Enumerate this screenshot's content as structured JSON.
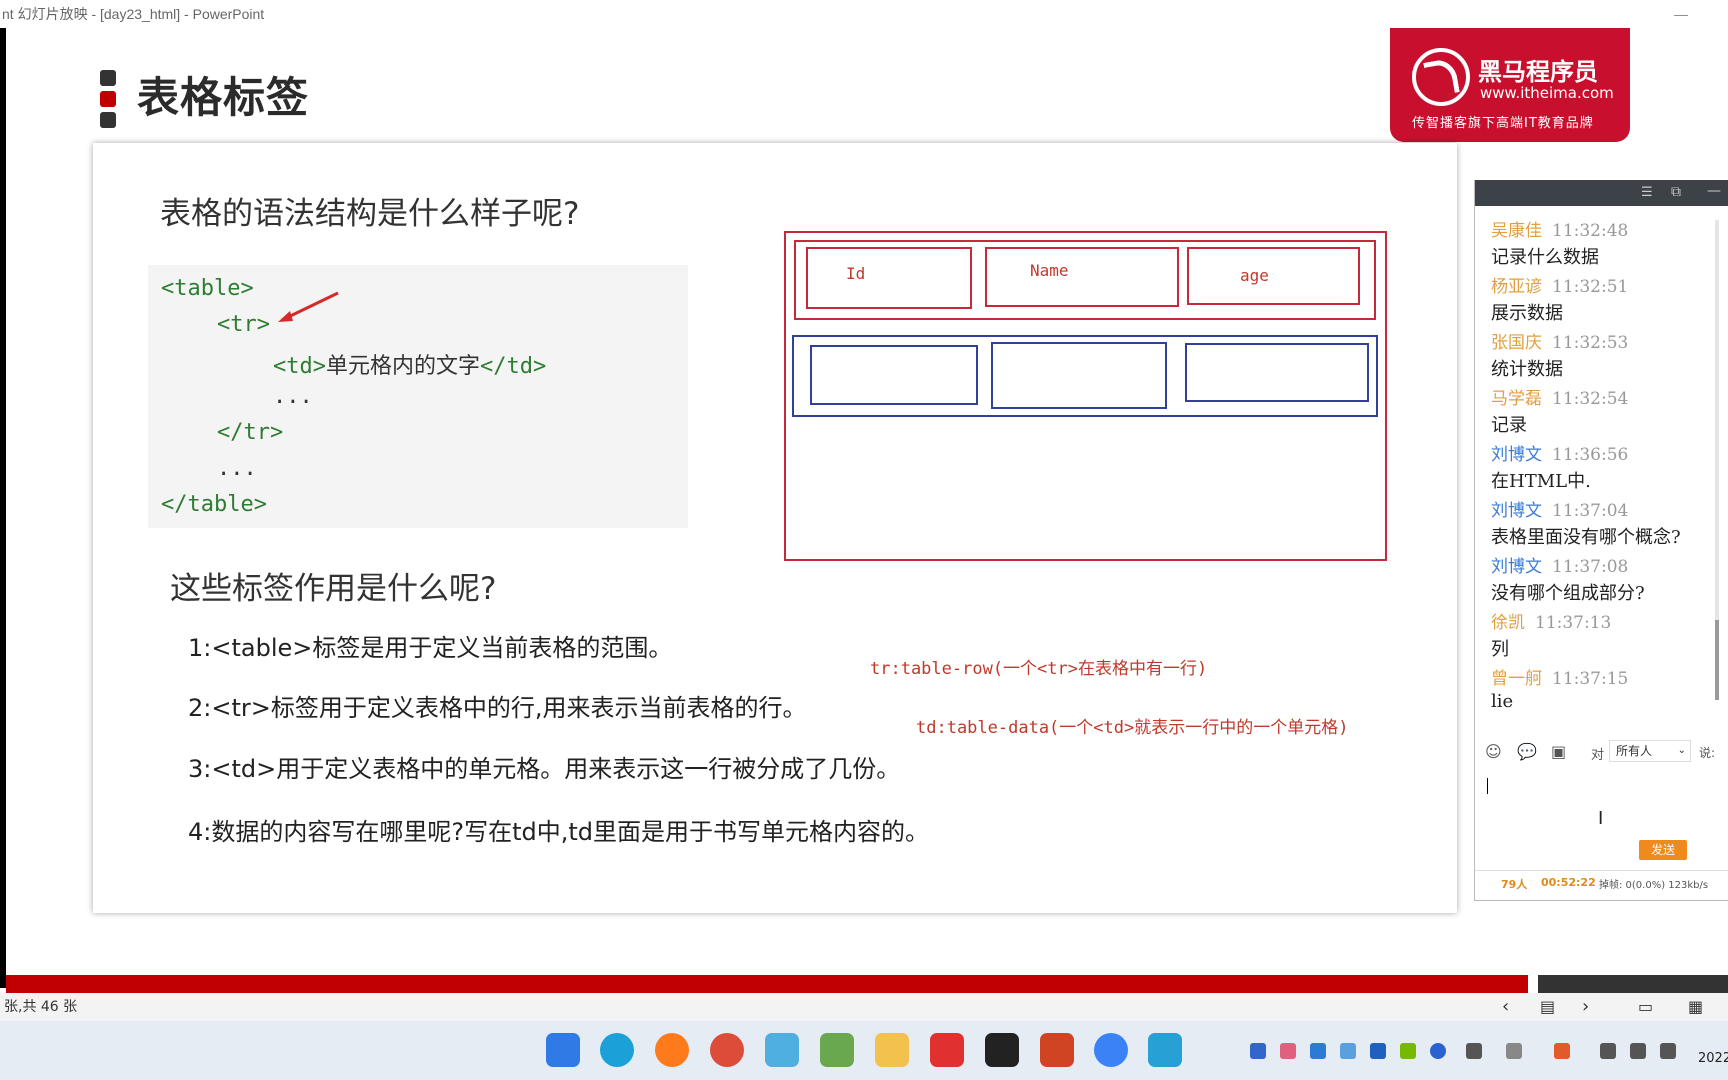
{
  "window": {
    "title": "nt 幻灯片放映 - [day23_html] - PowerPoint",
    "minimize": "—"
  },
  "slide": {
    "heading": "表格标签",
    "logo": {
      "name": "黑马程序员",
      "url": "www.itheima.com",
      "slogan": "传智播客旗下高端IT教育品牌"
    },
    "question1": "表格的语法结构是什么样子呢?",
    "code": {
      "l1": "<table>",
      "l2": "<tr>",
      "l3a": "<td>",
      "l3b": "单元格内的文字",
      "l3c": "</td>",
      "l4": "...",
      "l5": "</tr>",
      "l6": "...",
      "l7": "</table>"
    },
    "question2": "这些标签作用是什么呢?",
    "descriptions": [
      "1:<table>标签是用于定义当前表格的范围。",
      "2:<tr>标签用于定义表格中的行,用来表示当前表格的行。",
      "3:<td>用于定义表格中的单元格。用来表示这一行被分成了几份。",
      "4:数据的内容写在哪里呢?写在td中,td里面是用于书写单元格内容的。"
    ],
    "notes": {
      "tr": "tr:table-row(一个<tr>在表格中有一行)",
      "td": "td:table-data(一个<td>就表示一行中的一个单元格)"
    },
    "diagram": {
      "cells": [
        "Id",
        "Name",
        "age"
      ]
    },
    "colors": {
      "accent_red": "#c00000",
      "code_green": "#2e7d32",
      "note_red": "#c0392b"
    }
  },
  "chat": {
    "messages": [
      {
        "name": "吴康佳",
        "time": "11:32:48",
        "text": "记录什么数据",
        "color": "#e0a040"
      },
      {
        "name": "杨亚谚",
        "time": "11:32:51",
        "text": "展示数据",
        "color": "#e0a040"
      },
      {
        "name": "张国庆",
        "time": "11:32:53",
        "text": "统计数据",
        "color": "#e0a040"
      },
      {
        "name": "马学磊",
        "time": "11:32:54",
        "text": "记录",
        "color": "#e0a040"
      },
      {
        "name": "刘博文",
        "time": "11:36:56",
        "text": "在HTML中.",
        "color": "#3a7bd5"
      },
      {
        "name": "刘博文",
        "time": "11:37:04",
        "text": "表格里面没有哪个概念?",
        "color": "#3a7bd5"
      },
      {
        "name": "刘博文",
        "time": "11:37:08",
        "text": "没有哪个组成部分?",
        "color": "#3a7bd5"
      },
      {
        "name": "徐凯",
        "time": "11:37:13",
        "text": "列",
        "color": "#e0a040"
      },
      {
        "name": "曾一舸",
        "time": "11:37:15",
        "text": "lie",
        "color": "#e0a040"
      }
    ],
    "to_label": "对",
    "recipient": "所有人",
    "say_label": "说:",
    "send_label": "发送",
    "people": "79人",
    "duration": "00:52:22",
    "stats": "掉帧: 0(0.0%) 123kb/s"
  },
  "statusbar": {
    "slide_info": "张,共 46 张"
  },
  "taskbar": {
    "year": "2022"
  }
}
